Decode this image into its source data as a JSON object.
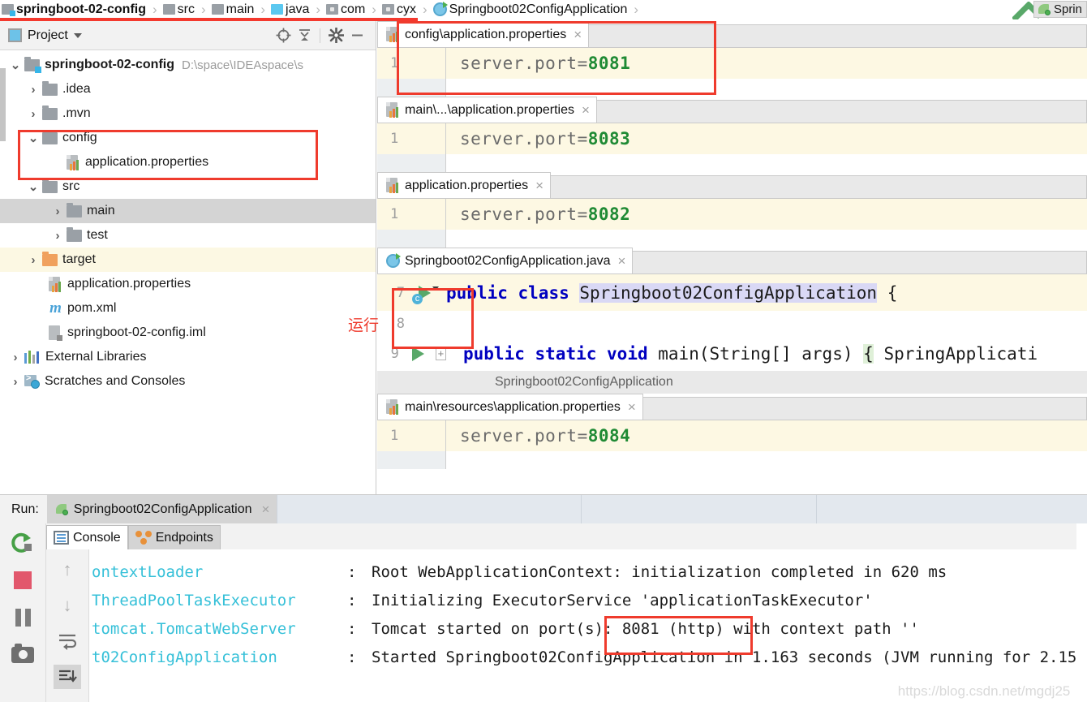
{
  "breadcrumb": {
    "items": [
      {
        "label": "springboot-02-config",
        "icon": "module-icon",
        "bold": true
      },
      {
        "label": "src",
        "icon": "folder-gray-icon",
        "bold": false
      },
      {
        "label": "main",
        "icon": "folder-gray-icon",
        "bold": false
      },
      {
        "label": "java",
        "icon": "folder-blue-icon",
        "bold": false
      },
      {
        "label": "com",
        "icon": "package-icon",
        "bold": false
      },
      {
        "label": "cyx",
        "icon": "package-icon",
        "bold": false
      },
      {
        "label": "Springboot02ConfigApplication",
        "icon": "java-class-icon",
        "bold": false
      }
    ],
    "separator": "›",
    "run_button_label": "",
    "spring_button_label": "Sprin"
  },
  "project_panel": {
    "title": "Project",
    "toolbar_icons": [
      "locate-icon",
      "collapse-all-icon",
      "settings-gear-icon",
      "minimize-icon"
    ],
    "tree": [
      {
        "label": "springboot-02-config",
        "path": "D:\\space\\IDEAspace\\s",
        "icon": "module-folder-icon",
        "arrow": "⌄",
        "depth": 0,
        "bold": true,
        "state": "normal"
      },
      {
        "label": ".idea",
        "path": "",
        "icon": "folder-icon",
        "arrow": "›",
        "depth": 1,
        "bold": false,
        "state": "normal"
      },
      {
        "label": ".mvn",
        "path": "",
        "icon": "folder-icon",
        "arrow": "›",
        "depth": 1,
        "bold": false,
        "state": "normal"
      },
      {
        "label": "config",
        "path": "",
        "icon": "folder-icon",
        "arrow": "⌄",
        "depth": 1,
        "bold": false,
        "state": "normal"
      },
      {
        "label": "application.properties",
        "path": "",
        "icon": "properties-file-icon",
        "arrow": "",
        "depth": 3,
        "bold": false,
        "state": "normal"
      },
      {
        "label": "src",
        "path": "",
        "icon": "folder-icon",
        "arrow": "⌄",
        "depth": 1,
        "bold": false,
        "state": "normal"
      },
      {
        "label": "main",
        "path": "",
        "icon": "folder-icon",
        "arrow": "›",
        "depth": 2,
        "bold": false,
        "state": "selected"
      },
      {
        "label": "test",
        "path": "",
        "icon": "folder-icon",
        "arrow": "›",
        "depth": 2,
        "bold": false,
        "state": "normal"
      },
      {
        "label": "target",
        "path": "",
        "icon": "folder-orange-icon",
        "arrow": "›",
        "depth": 1,
        "bold": false,
        "state": "highlighted"
      },
      {
        "label": "application.properties",
        "path": "",
        "icon": "properties-file-icon",
        "arrow": "",
        "depth": 2,
        "bold": false,
        "state": "normal"
      },
      {
        "label": "pom.xml",
        "path": "",
        "icon": "maven-m-icon",
        "arrow": "",
        "depth": 2,
        "bold": false,
        "state": "normal"
      },
      {
        "label": "springboot-02-config.iml",
        "path": "",
        "icon": "iml-file-icon",
        "arrow": "",
        "depth": 2,
        "bold": false,
        "state": "normal"
      },
      {
        "label": "External Libraries",
        "path": "",
        "icon": "libraries-icon",
        "arrow": "›",
        "depth": 0,
        "bold": false,
        "state": "normal"
      },
      {
        "label": "Scratches and Consoles",
        "path": "",
        "icon": "scratches-icon",
        "arrow": "›",
        "depth": 0,
        "bold": false,
        "state": "normal"
      }
    ]
  },
  "annotations": {
    "run_label_cn": "运行",
    "highlight_color": "#ef3b2d"
  },
  "editors": [
    {
      "tab_label": "config\\application.properties",
      "tab_icon": "properties-file-icon",
      "close_icon": "×",
      "line_number": "1",
      "code_key": "server.port=",
      "code_value": "8081",
      "highlighted": true
    },
    {
      "tab_label": "main\\...\\application.properties",
      "tab_icon": "properties-file-icon",
      "close_icon": "×",
      "line_number": "1",
      "code_key": "server.port=",
      "code_value": "8083",
      "highlighted": false
    },
    {
      "tab_label": "application.properties",
      "tab_icon": "properties-file-icon",
      "close_icon": "×",
      "line_number": "1",
      "code_key": "server.port=",
      "code_value": "8082",
      "highlighted": false
    }
  ],
  "java_editor": {
    "tab_label": "Springboot02ConfigApplication.java",
    "tab_icon": "java-class-icon",
    "close_icon": "×",
    "line_numbers": [
      "7",
      "8",
      "9"
    ],
    "line7": {
      "kw1": "public",
      "kw2": "class",
      "classname": "Springboot02ConfigApplication",
      "brace": "{"
    },
    "line9": {
      "kw1": "public",
      "kw2": "static",
      "kw3": "void",
      "method": "main",
      "params": "(String[] args)",
      "brace": "{",
      "trailing": "SpringApplicati"
    },
    "status_strip": "Springboot02ConfigApplication"
  },
  "bottom_editor": {
    "tab_label": "main\\resources\\application.properties",
    "tab_icon": "properties-file-icon",
    "close_icon": "×",
    "line_number": "1",
    "code_key": "server.port=",
    "code_value": "8084"
  },
  "run_panel": {
    "label": "Run:",
    "tab_label": "Springboot02ConfigApplication",
    "tab_icon": "spring-leaf-icon",
    "close_icon": "×",
    "sidebar_icons": [
      "rerun-icon",
      "stop-icon",
      "pause-icon",
      "screenshot-icon"
    ],
    "console_icons": [
      "scroll-up-icon",
      "scroll-down-icon",
      "soft-wrap-icon",
      "scroll-to-end-icon"
    ],
    "tabs": [
      {
        "label": "Console",
        "icon": "console-icon",
        "active": true
      },
      {
        "label": "Endpoints",
        "icon": "endpoints-icon",
        "active": false
      }
    ],
    "console_lines": [
      {
        "logger": "ontextLoader",
        "separator": ":",
        "message": "Root WebApplicationContext: initialization completed in 620 ms"
      },
      {
        "logger": "ThreadPoolTaskExecutor",
        "separator": ":",
        "message": "Initializing ExecutorService 'applicationTaskExecutor'"
      },
      {
        "logger": "tomcat.TomcatWebServer",
        "separator": ":",
        "message": "Tomcat started on port(s): 8081 (http) with context path ''"
      },
      {
        "logger": "t02ConfigApplication",
        "separator": ":",
        "message": "Started Springboot02ConfigApplication in 1.163 seconds (JVM running for 2.15"
      }
    ],
    "watermark": "https://blog.csdn.net/mgdj25"
  }
}
